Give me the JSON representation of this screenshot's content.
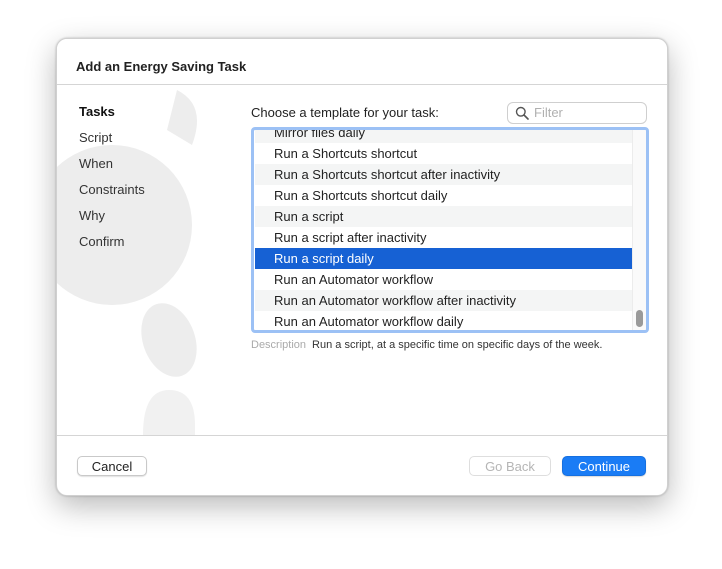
{
  "dialog": {
    "title": "Add an Energy Saving Task"
  },
  "sidebar": {
    "items": [
      {
        "label": "Tasks",
        "active": true
      },
      {
        "label": "Script",
        "active": false
      },
      {
        "label": "When",
        "active": false
      },
      {
        "label": "Constraints",
        "active": false
      },
      {
        "label": "Why",
        "active": false
      },
      {
        "label": "Confirm",
        "active": false
      }
    ]
  },
  "main": {
    "choose_label": "Choose a template for your task:",
    "filter": {
      "placeholder": "Filter",
      "value": "",
      "icon": "search-icon"
    },
    "templates": [
      {
        "label": "Mirror files daily",
        "selected": false
      },
      {
        "label": "Run a Shortcuts shortcut",
        "selected": false
      },
      {
        "label": "Run a Shortcuts shortcut after inactivity",
        "selected": false
      },
      {
        "label": "Run a Shortcuts shortcut daily",
        "selected": false
      },
      {
        "label": "Run a script",
        "selected": false
      },
      {
        "label": "Run a script after inactivity",
        "selected": false
      },
      {
        "label": "Run a script daily",
        "selected": true
      },
      {
        "label": "Run an Automator workflow",
        "selected": false
      },
      {
        "label": "Run an Automator workflow after inactivity",
        "selected": false
      },
      {
        "label": "Run an Automator workflow daily",
        "selected": false
      }
    ],
    "description_label": "Description",
    "description_text": "Run a script, at a specific time on specific days of the week."
  },
  "footer": {
    "cancel_label": "Cancel",
    "back_label": "Go Back",
    "continue_label": "Continue"
  },
  "colors": {
    "accent": "#1a7cf5",
    "selection": "#1661d4",
    "focus_ring": "#9cc1f5"
  }
}
